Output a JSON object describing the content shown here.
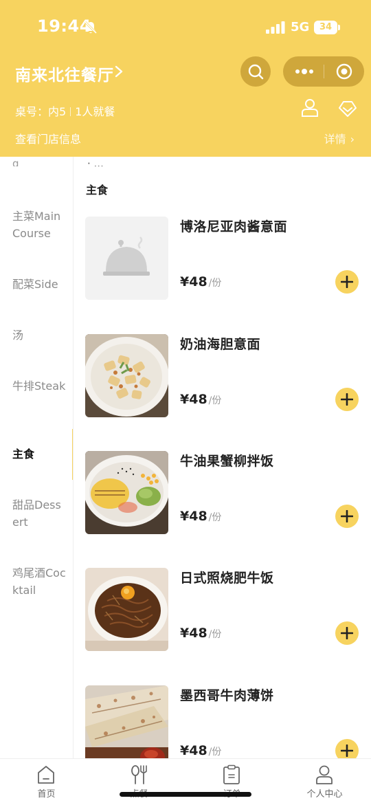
{
  "status_bar": {
    "time": "19:44",
    "network": "5G",
    "battery": "34"
  },
  "header": {
    "store_name": "南来北往餐厅",
    "table_label": "桌号：内5",
    "diners": "1人就餐",
    "store_info_link": "查看门店信息",
    "details_link": "详情"
  },
  "sidebar": {
    "cut_item": "g",
    "categories": [
      {
        "label": "主菜Main Course"
      },
      {
        "label": "配菜Side"
      },
      {
        "label": "汤"
      },
      {
        "label": "牛排Steak"
      },
      {
        "label": "主食",
        "active": true
      },
      {
        "label": "甜品Dessert"
      },
      {
        "label": "鸡尾酒Cocktail"
      }
    ]
  },
  "menu": {
    "cut_text": "· ...",
    "section_title": "主食",
    "dishes": [
      {
        "name": "博洛尼亚肉酱意面",
        "price": "¥48",
        "unit": "/份",
        "image": "placeholder-cloche"
      },
      {
        "name": "奶油海胆意面",
        "price": "¥48",
        "unit": "/份",
        "image": "pasta"
      },
      {
        "name": "牛油果蟹柳拌饭",
        "price": "¥48",
        "unit": "/份",
        "image": "rice-bowl"
      },
      {
        "name": "日式照烧肥牛饭",
        "price": "¥48",
        "unit": "/份",
        "image": "beef-rice"
      },
      {
        "name": "墨西哥牛肉薄饼",
        "price": "¥48",
        "unit": "/份",
        "image": "quesadilla"
      }
    ]
  },
  "tabbar": {
    "tabs": [
      {
        "label": "首页",
        "icon": "home-icon"
      },
      {
        "label": "点餐",
        "icon": "utensils-icon"
      },
      {
        "label": "订单",
        "icon": "clipboard-icon"
      },
      {
        "label": "个人中心",
        "icon": "user-icon"
      }
    ]
  },
  "colors": {
    "accent": "#f7d35f",
    "capsule": "#cfa73b",
    "text": "#222222",
    "muted": "#8a8a8a"
  }
}
